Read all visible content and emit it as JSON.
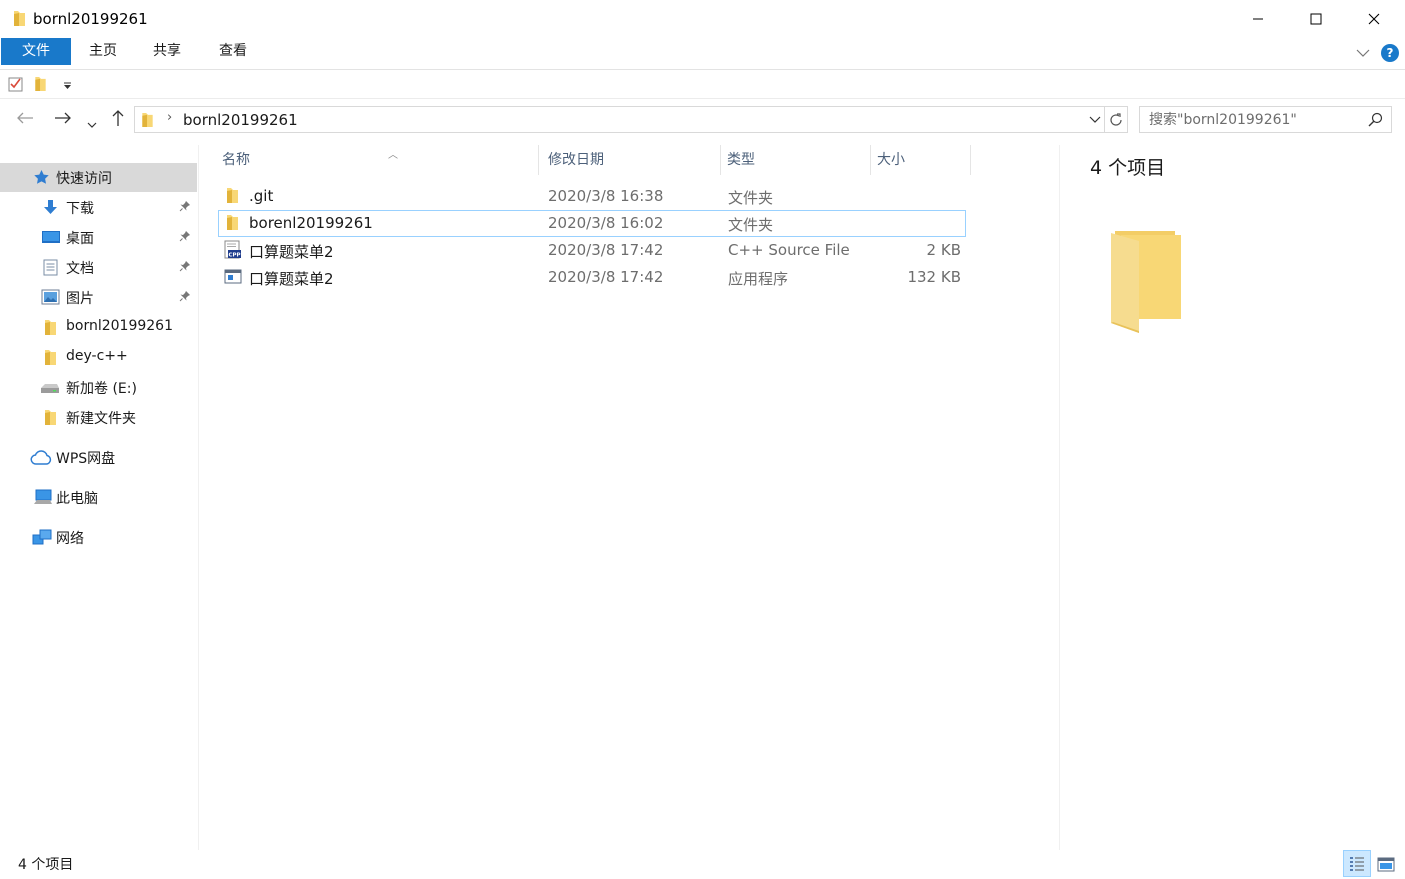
{
  "window": {
    "title": "bornl20199261"
  },
  "ribbon": {
    "tabs": [
      "文件",
      "主页",
      "共享",
      "查看"
    ]
  },
  "address": {
    "path": "bornl20199261",
    "search_placeholder": "搜索\"bornl20199261\""
  },
  "sidebar": {
    "quick_access": "快速访问",
    "items": [
      {
        "label": "下载",
        "icon": "download-icon",
        "pinned": true
      },
      {
        "label": "桌面",
        "icon": "desktop-icon",
        "pinned": true
      },
      {
        "label": "文档",
        "icon": "document-icon",
        "pinned": true
      },
      {
        "label": "图片",
        "icon": "pictures-icon",
        "pinned": true
      },
      {
        "label": "bornl20199261",
        "icon": "folder-icon",
        "pinned": false
      },
      {
        "label": "dey-c++",
        "icon": "folder-icon",
        "pinned": false
      },
      {
        "label": "新加卷 (E:)",
        "icon": "drive-icon",
        "pinned": false
      },
      {
        "label": "新建文件夹",
        "icon": "folder-icon",
        "pinned": false
      }
    ],
    "wps": "WPS网盘",
    "this_pc": "此电脑",
    "network": "网络"
  },
  "columns": {
    "name": "名称",
    "modified": "修改日期",
    "type": "类型",
    "size": "大小"
  },
  "files": [
    {
      "name": ".git",
      "modified": "2020/3/8 16:38",
      "type": "文件夹",
      "size": "",
      "icon": "folder-icon"
    },
    {
      "name": "borenl20199261",
      "modified": "2020/3/8 16:02",
      "type": "文件夹",
      "size": "",
      "icon": "folder-icon"
    },
    {
      "name": "口算题菜单2",
      "modified": "2020/3/8 17:42",
      "type": "C++ Source File",
      "size": "2 KB",
      "icon": "cpp-file-icon"
    },
    {
      "name": "口算题菜单2",
      "modified": "2020/3/8 17:42",
      "type": "应用程序",
      "size": "132 KB",
      "icon": "application-icon"
    }
  ],
  "preview": {
    "count": "4 个项目"
  },
  "status": {
    "count": "4 个项目"
  },
  "colors": {
    "accent": "#1979ca",
    "selected_nav": "#d9d9d9",
    "folder": "#f8d775",
    "focus_border": "#99d1ff"
  }
}
